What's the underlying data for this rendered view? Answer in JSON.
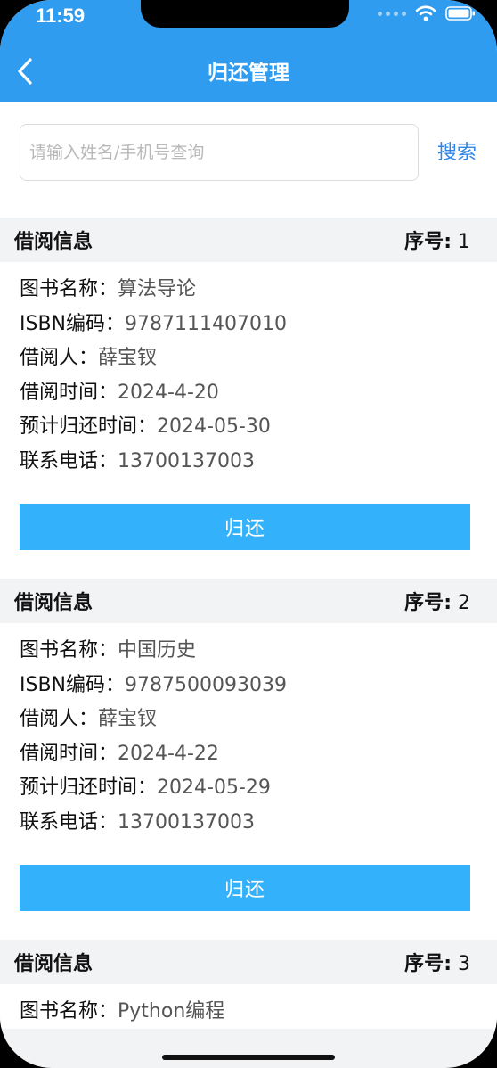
{
  "status_bar": {
    "time": "11:59"
  },
  "header": {
    "title": "归还管理"
  },
  "search": {
    "placeholder": "请输入姓名/手机号查询",
    "value": "",
    "button_label": "搜索"
  },
  "labels": {
    "section_title": "借阅信息",
    "index": "序号",
    "book_name": "图书名称：",
    "isbn": "ISBN编码：",
    "borrower": "借阅人：",
    "borrow_time": "借阅时间：",
    "due_time": "预计归还时间：",
    "phone": "联系电话：",
    "return_button": "归还"
  },
  "records": [
    {
      "index": "1",
      "book_name": "算法导论",
      "isbn": "9787111407010",
      "borrower": "薛宝钗",
      "borrow_time": "2024-4-20",
      "due_time": "2024-05-30",
      "phone": "13700137003"
    },
    {
      "index": "2",
      "book_name": "中国历史",
      "isbn": "9787500093039",
      "borrower": "薛宝钗",
      "borrow_time": "2024-4-22",
      "due_time": "2024-05-29",
      "phone": "13700137003"
    },
    {
      "index": "3",
      "book_name": "Python编程"
    }
  ],
  "colors": {
    "header_bg": "#2f9cf0",
    "button_bg": "#33b1fb",
    "search_link": "#2f86e6"
  }
}
